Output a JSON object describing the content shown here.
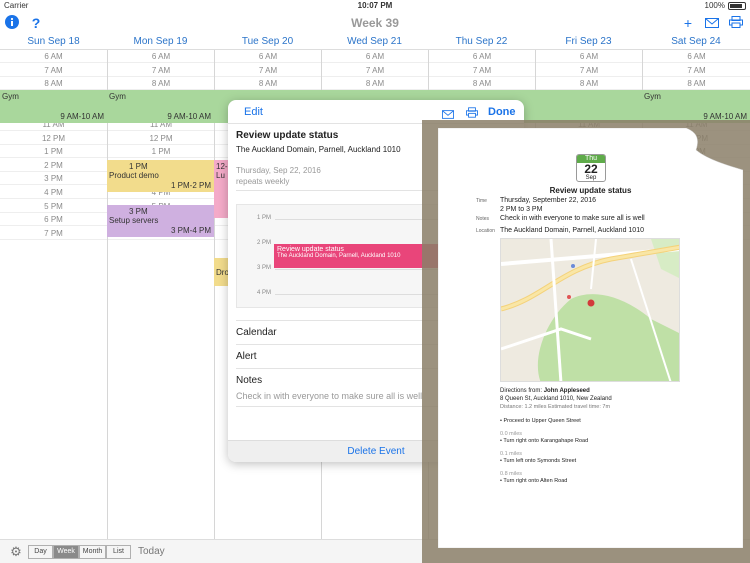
{
  "status": {
    "carrier": "Carrier",
    "time": "10:07 PM",
    "battery": "100%"
  },
  "nav": {
    "title": "Week 39"
  },
  "days": [
    {
      "label": "Sun Sep 18"
    },
    {
      "label": "Mon Sep 19"
    },
    {
      "label": "Tue Sep 20"
    },
    {
      "label": "Wed Sep 21"
    },
    {
      "label": "Thu Sep 22"
    },
    {
      "label": "Fri Sep 23"
    },
    {
      "label": "Sat Sep 24"
    }
  ],
  "hours": [
    "6 AM",
    "7 AM",
    "8 AM",
    "9 AM",
    "10 AM",
    "11 AM",
    "12 PM",
    "1 PM",
    "2 PM",
    "3 PM",
    "4 PM",
    "5 PM",
    "6 PM",
    "7 PM"
  ],
  "events": {
    "gym": {
      "title": "Gym",
      "range": "9 AM-10 AM",
      "color": "#a9d79c"
    },
    "product_demo": {
      "time": "1 PM",
      "title": "Product demo",
      "range": "1 PM-2 PM",
      "color": "#f2dc8c"
    },
    "setup_servers": {
      "time": "3 PM",
      "title": "Setup servers",
      "range": "3 PM-4 PM",
      "color": "#cfb0e0"
    },
    "tue_partial_1": {
      "text": "12-",
      "text2": "Lu",
      "color": "#f4aac8"
    },
    "tue_partial_2": {
      "text": "Dro",
      "color": "#f2dc8c"
    }
  },
  "toolbar": {
    "day": "Day",
    "week": "Week",
    "month": "Month",
    "list": "List",
    "today": "Today"
  },
  "popover": {
    "edit": "Edit",
    "done": "Done",
    "title": "Review update status",
    "location": "The Auckland Domain, Parnell, Auckland 1010",
    "date": "Thursday, Sep 22, 2016",
    "repeat": "repeats weekly",
    "mini_hours": [
      "1 PM",
      "2 PM",
      "3 PM",
      "4 PM"
    ],
    "mini_event_title": "Review update status",
    "mini_event_loc": "The Auckland Domain, Parnell, Auckland 1010",
    "calendar_label": "Calendar",
    "alert_label": "Alert",
    "notes_label": "Notes",
    "notes_text": "Check in with everyone to make sure all is well",
    "delete": "Delete Event"
  },
  "preview": {
    "badge_day": "Thu",
    "badge_date": "22",
    "badge_month": "Sep",
    "title": "Review update status",
    "time_label": "Time",
    "time_line1": "Thursday, September 22, 2016",
    "time_line2": "2 PM to 3 PM",
    "notes_label": "Notes",
    "notes": "Check in with everyone to make sure all is well",
    "location_label": "Location",
    "location": "The Auckland Domain, Parnell, Auckland 1010",
    "directions_prefix": "Directions from: ",
    "directions_from": "John Appleseed",
    "address": "8 Queen St, Auckland 1010, New Zealand",
    "distance": "Distance: 1.2 miles   Estimated travel time: 7m",
    "steps": [
      {
        "dist": "",
        "text": "• Proceed to Upper Queen Street"
      },
      {
        "dist": "0.0 miles",
        "text": "• Turn right onto Karangahape Road"
      },
      {
        "dist": "0.1 miles",
        "text": "• Turn left onto Symonds Street"
      },
      {
        "dist": "0.8 miles",
        "text": "• Turn right onto Alten Road"
      }
    ]
  }
}
